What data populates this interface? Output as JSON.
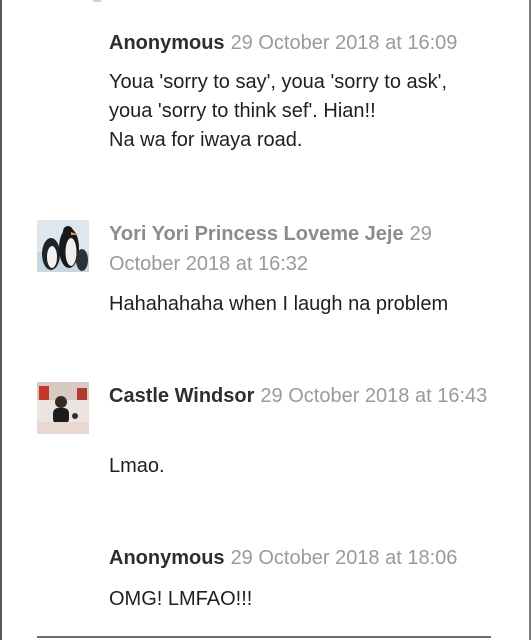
{
  "comments": [
    {
      "author": "Anonymous",
      "timestamp": "29 October 2018 at 16:09",
      "body_lines": [
        "Youa 'sorry to say', youa 'sorry to ask',",
        "youa 'sorry to think sef'. Hian!!",
        "Na wa for iwaya road."
      ]
    },
    {
      "author": "Yori Yori Princess Loveme Jeje",
      "timestamp": "29 October 2018 at 16:32",
      "body_lines": [
        "Hahahahaha when I laugh na problem"
      ]
    },
    {
      "author": "Castle Windsor",
      "timestamp": "29 October 2018 at 16:43",
      "body_lines": [
        "Lmao."
      ]
    },
    {
      "author": "Anonymous",
      "timestamp": "29 October 2018 at 18:06",
      "body_lines": [
        "OMG! LMFAO!!!"
      ]
    }
  ],
  "colors": {
    "author_dark": "#2e2e2e",
    "author_gray": "#8c8c8c",
    "timestamp": "#9a9a9a",
    "body": "#1f1f1f"
  }
}
